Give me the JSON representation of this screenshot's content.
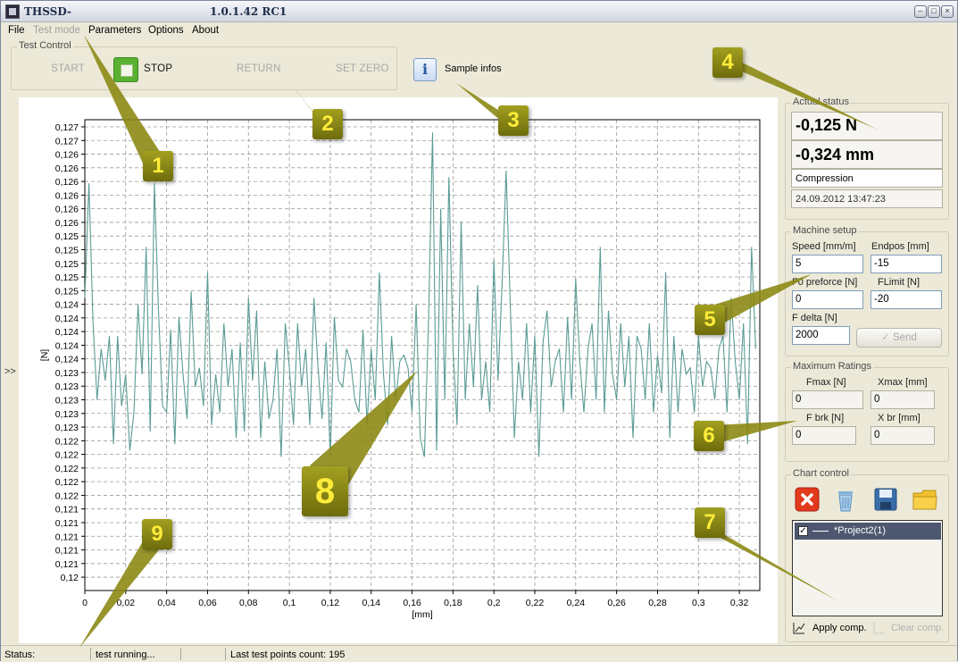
{
  "window": {
    "title": "THSSD-",
    "title_version": "1.0.1.42 RC1",
    "controls": [
      "minimize-icon",
      "maximize-icon",
      "close-icon"
    ]
  },
  "menu": {
    "items": [
      {
        "label": "File",
        "enabled": true
      },
      {
        "label": "Test mode",
        "enabled": false
      },
      {
        "label": "Parameters",
        "enabled": true
      },
      {
        "label": "Options",
        "enabled": true
      },
      {
        "label": "About",
        "enabled": true
      }
    ]
  },
  "test_control": {
    "title": "Test Control",
    "start": "START",
    "stop": "STOP",
    "return": "RETURN",
    "set_zero": "SET ZERO",
    "sample_infos": "Sample infos"
  },
  "actual_status": {
    "title": "Actual status",
    "force": "-0,125 N",
    "position": "-0,324 mm",
    "mode": "Compression",
    "timestamp": "24.09.2012 13:47:23"
  },
  "machine_setup": {
    "title": "Machine setup",
    "speed_label": "Speed [mm/m]",
    "speed_value": "5",
    "endpos_label": "Endpos [mm]",
    "endpos_value": "-15",
    "f0_label": "F0 preforce [N]",
    "f0_value": "0",
    "flimit_label": "FLimit [N]",
    "flimit_value": "-20",
    "fdelta_label": "F delta [N]",
    "fdelta_value": "2000",
    "send_label": "Send"
  },
  "max_ratings": {
    "title": "Maximum Ratings",
    "fmax_label": "Fmax [N]",
    "fmax_value": "0",
    "xmax_label": "Xmax [mm]",
    "xmax_value": "0",
    "fbrk_label": "F brk [N]",
    "fbrk_value": "0",
    "xbr_label": "X br [mm]",
    "xbr_value": "0"
  },
  "chart_control": {
    "title": "Chart control",
    "icons": [
      "delete-icon",
      "trash-icon",
      "save-icon",
      "folder-icon"
    ],
    "project": "*Project2(1)",
    "project_checked": true,
    "apply_label": "Apply comp.",
    "clear_label": "Clear comp."
  },
  "statusbar": {
    "status_label": "Status:",
    "status_value": "test running...",
    "points": "Last test points count: 195"
  },
  "panel_toggle": ">>",
  "callouts": [
    "1",
    "2",
    "3",
    "4",
    "5",
    "6",
    "7",
    "8",
    "9"
  ],
  "chart_data": {
    "type": "line",
    "xlabel": "[mm]",
    "ylabel": "[N]",
    "xlim": [
      0,
      0.33
    ],
    "ylim": [
      0.1198,
      0.1272
    ],
    "x_ticks": [
      "0",
      "0,02",
      "0,04",
      "0,06",
      "0,08",
      "0,1",
      "0,12",
      "0,14",
      "0,16",
      "0,18",
      "0,2",
      "0,22",
      "0,24",
      "0,26",
      "0,28",
      "0,3",
      "0,32"
    ],
    "y_ticks": [
      "0,127",
      "0,127",
      "0,126",
      "0,126",
      "0,126",
      "0,126",
      "0,126",
      "0,126",
      "0,125",
      "0,125",
      "0,125",
      "0,125",
      "0,125",
      "0,124",
      "0,124",
      "0,124",
      "0,124",
      "0,124",
      "0,123",
      "0,123",
      "0,123",
      "0,123",
      "0,123",
      "0,122",
      "0,122",
      "0,122",
      "0,122",
      "0,122",
      "0,121",
      "0,121",
      "0,121",
      "0,121",
      "0,121",
      "0,12",
      "0,12"
    ],
    "grid": true,
    "series_color": "#5a9c94",
    "series": [
      {
        "x": [
          0.0,
          0.002,
          0.004,
          0.006,
          0.008,
          0.01,
          0.012,
          0.014,
          0.016,
          0.018,
          0.02,
          0.022,
          0.024,
          0.026,
          0.028,
          0.03,
          0.032,
          0.034,
          0.036,
          0.038,
          0.04,
          0.042,
          0.044,
          0.046,
          0.048,
          0.05,
          0.052,
          0.054,
          0.056,
          0.058,
          0.06,
          0.062,
          0.064,
          0.066,
          0.068,
          0.07,
          0.072,
          0.074,
          0.076,
          0.078,
          0.08,
          0.082,
          0.084,
          0.086,
          0.088,
          0.09,
          0.092,
          0.094,
          0.096,
          0.098,
          0.1,
          0.102,
          0.104,
          0.106,
          0.108,
          0.11,
          0.112,
          0.114,
          0.116,
          0.118,
          0.12,
          0.122,
          0.124,
          0.126,
          0.128,
          0.13,
          0.132,
          0.134,
          0.136,
          0.138,
          0.14,
          0.142,
          0.144,
          0.146,
          0.148,
          0.15,
          0.152,
          0.154,
          0.156,
          0.158,
          0.16,
          0.162,
          0.164,
          0.166,
          0.168,
          0.17,
          0.172,
          0.174,
          0.176,
          0.178,
          0.18,
          0.182,
          0.184,
          0.186,
          0.188,
          0.19,
          0.192,
          0.194,
          0.196,
          0.198,
          0.2,
          0.202,
          0.204,
          0.206,
          0.208,
          0.21,
          0.212,
          0.214,
          0.216,
          0.218,
          0.22,
          0.222,
          0.224,
          0.226,
          0.228,
          0.23,
          0.232,
          0.234,
          0.236,
          0.238,
          0.24,
          0.242,
          0.244,
          0.246,
          0.248,
          0.25,
          0.252,
          0.254,
          0.256,
          0.258,
          0.26,
          0.262,
          0.264,
          0.266,
          0.268,
          0.27,
          0.272,
          0.274,
          0.276,
          0.278,
          0.28,
          0.282,
          0.284,
          0.286,
          0.288,
          0.29,
          0.292,
          0.294,
          0.296,
          0.298,
          0.3,
          0.302,
          0.304,
          0.306,
          0.308,
          0.31,
          0.312,
          0.314,
          0.316,
          0.318,
          0.32,
          0.322,
          0.324,
          0.326,
          0.328
        ],
        "values": [
          0.1244,
          0.1262,
          0.124,
          0.1228,
          0.1236,
          0.1231,
          0.1238,
          0.1221,
          0.1238,
          0.1227,
          0.1232,
          0.122,
          0.1226,
          0.1243,
          0.1232,
          0.1252,
          0.1223,
          0.1262,
          0.1242,
          0.1227,
          0.1226,
          0.1239,
          0.1221,
          0.1241,
          0.1232,
          0.1225,
          0.1245,
          0.123,
          0.1233,
          0.1227,
          0.1248,
          0.1224,
          0.1232,
          0.1226,
          0.124,
          0.123,
          0.1236,
          0.1222,
          0.1237,
          0.1223,
          0.1244,
          0.1231,
          0.1242,
          0.1222,
          0.1234,
          0.1225,
          0.1228,
          0.1236,
          0.1219,
          0.124,
          0.1233,
          0.1224,
          0.124,
          0.123,
          0.1236,
          0.1224,
          0.1244,
          0.1233,
          0.1225,
          0.1237,
          0.1219,
          0.1241,
          0.1231,
          0.123,
          0.1236,
          0.1234,
          0.1228,
          0.1226,
          0.1239,
          0.1224,
          0.1236,
          0.1228,
          0.1248,
          0.1232,
          0.1224,
          0.1238,
          0.1228,
          0.1234,
          0.1235,
          0.1233,
          0.1226,
          0.1243,
          0.1222,
          0.1219,
          0.124,
          0.127,
          0.122,
          0.1258,
          0.1228,
          0.1263,
          0.1236,
          0.1224,
          0.1256,
          0.1228,
          0.124,
          0.123,
          0.1246,
          0.1228,
          0.1234,
          0.1226,
          0.125,
          0.1231,
          0.1246,
          0.1264,
          0.1243,
          0.1222,
          0.1234,
          0.1228,
          0.124,
          0.1226,
          0.1238,
          0.1219,
          0.1237,
          0.1242,
          0.123,
          0.1234,
          0.1236,
          0.1226,
          0.1241,
          0.1228,
          0.1247,
          0.1234,
          0.1226,
          0.1236,
          0.124,
          0.1228,
          0.1252,
          0.1226,
          0.1242,
          0.1232,
          0.1228,
          0.124,
          0.123,
          0.1238,
          0.1222,
          0.1238,
          0.1236,
          0.1228,
          0.124,
          0.1226,
          0.1235,
          0.1229,
          0.1248,
          0.1222,
          0.1238,
          0.1226,
          0.1236,
          0.1232,
          0.1233,
          0.1226,
          0.1238,
          0.123,
          0.1234,
          0.1233,
          0.1228,
          0.1236,
          0.1238,
          0.1226,
          0.1244,
          0.1234,
          0.1228,
          0.124,
          0.1221,
          0.1252,
          0.1236
        ]
      }
    ]
  }
}
